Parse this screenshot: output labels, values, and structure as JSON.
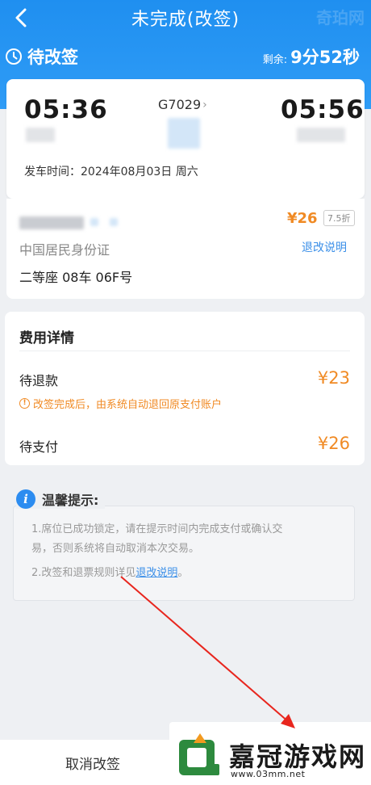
{
  "nav": {
    "title": "未完成(改签)"
  },
  "watermark_top": "奇珀网",
  "status": {
    "label": "待改签",
    "remain_label": "剩余:",
    "remain_value": "9分52秒"
  },
  "train": {
    "depart_time": "05:36",
    "arrive_time": "05:56",
    "train_no": "G7029",
    "depart_date": "发车时间：2024年08月03日 周六"
  },
  "passenger": {
    "price": "¥26",
    "discount": "7.5折",
    "id_type": "中国居民身份证",
    "refund_link": "退改说明",
    "seat": "二等座 08车 06F号"
  },
  "fees": {
    "title": "费用详情",
    "refund_label": "待退款",
    "refund_amount": "¥23",
    "refund_note": "改签完成后，由系统自动退回原支付账户",
    "pay_label": "待支付",
    "pay_amount": "¥26"
  },
  "tips": {
    "title": "温馨提示:",
    "line1a": "1.席位已成功锁定，请在提示时间内完成支付或确认交",
    "line1b": "易，否则系统将自动取消本次交易。",
    "line2_prefix": "2.改签和退票规则详见",
    "line2_link": "退改说明",
    "line2_suffix": "。"
  },
  "bottom": {
    "cancel": "取消改签"
  },
  "logo": {
    "text": "嘉冠游戏网",
    "url": "www.03mm.net"
  },
  "colors": {
    "primary": "#2f9cf6",
    "accent": "#f08a24",
    "link": "#3b8fe8",
    "arrow": "#e8261e"
  }
}
